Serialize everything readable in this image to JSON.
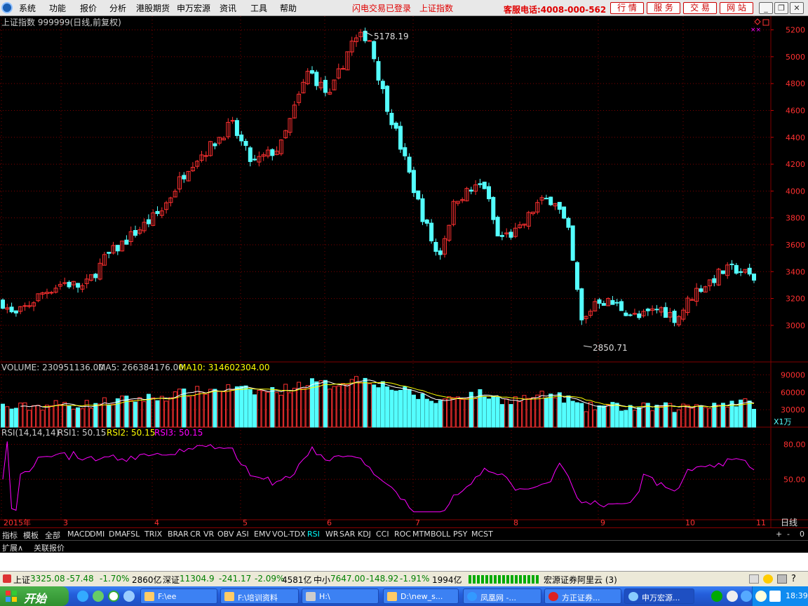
{
  "menu": {
    "items": [
      "系统",
      "功能",
      "报价",
      "分析",
      "港股期货",
      "申万宏源",
      "资讯",
      "工具",
      "帮助"
    ],
    "login_status": "闪电交易已登录",
    "current_index": "上证指数",
    "hotline": "客服电话:4008-000-562",
    "nav_buttons": [
      "行 情",
      "服 务",
      "交 易",
      "网 站"
    ]
  },
  "chart_header": {
    "title": "上证指数 999999(日线,前复权)",
    "volume_label": "VOLUME: 230951136.00",
    "ma5_label": "MA5: 266384176.00",
    "ma10_label": "MA10: 314602304.00",
    "rsi_label": "RSI(14,14,14)",
    "rsi1_label": "RSI1: 50.15",
    "rsi2_label": "RSI2: 50.15",
    "rsi3_label": "RSI3: 50.15",
    "volume_unit": "X1万",
    "period_label": "日线"
  },
  "chart_data": {
    "type": "candlestick",
    "price_axis_ticks": [
      "5200",
      "5000",
      "4800",
      "4600",
      "4400",
      "4200",
      "4000",
      "3800",
      "3600",
      "3400",
      "3200",
      "3000"
    ],
    "price_range": [
      2780,
      5250
    ],
    "volume_axis_ticks": [
      "90000",
      "60000",
      "30000"
    ],
    "rsi_axis_ticks": [
      "80.00",
      "50.00"
    ],
    "month_ticks": [
      "2015年",
      "3",
      "4",
      "5",
      "6",
      "7",
      "8",
      "9",
      "10",
      "11"
    ],
    "high_annotation": "5178.19",
    "low_annotation": "2850.71",
    "colors": {
      "up": "#ff3030",
      "down": "#54ffff",
      "ma5": "#ffffff",
      "ma10": "#ffff00",
      "rsi": "#ff00ff",
      "grid": "#800000"
    }
  },
  "indicator_tabs": [
    "指标",
    "模板",
    "全部",
    "MACD",
    "DMI",
    "DMA",
    "FSL",
    "TRIX",
    "BRAR",
    "CR",
    "VR",
    "OBV",
    "ASI",
    "EMV",
    "VOL-TDX",
    "RSI",
    "WR",
    "SAR",
    "KDJ",
    "CCI",
    "ROC",
    "MTM",
    "BOLL",
    "PSY",
    "MCST"
  ],
  "active_indicator": "RSI",
  "zoom_buttons": [
    "+",
    "-",
    "0"
  ],
  "extension_tabs": [
    "扩展∧",
    "关联报价"
  ],
  "status": {
    "sh_label": "上证",
    "sh_value": "3325.08",
    "sh_change": "-57.48",
    "sh_pct": "-1.70%",
    "sh_amount": "2860亿",
    "sz_label": "深证",
    "sz_value": "11304.9",
    "sz_change": "-241.17",
    "sz_pct": "-2.09%",
    "sz_amount": "4581亿",
    "sme_label": "中小",
    "sme_value": "7647.00",
    "sme_change": "-148.92",
    "sme_pct": "-1.91%",
    "sme_amount": "1994亿",
    "broker": "宏源证券阿里云 (3)"
  },
  "taskbar": {
    "start_label": "开始",
    "tasks": [
      "F:\\ee",
      "F:\\培训资料",
      "H:\\",
      "D:\\new_s...",
      "凤凰网 -...",
      "方正证券...",
      "申万宏源..."
    ],
    "clock": "18:39"
  }
}
